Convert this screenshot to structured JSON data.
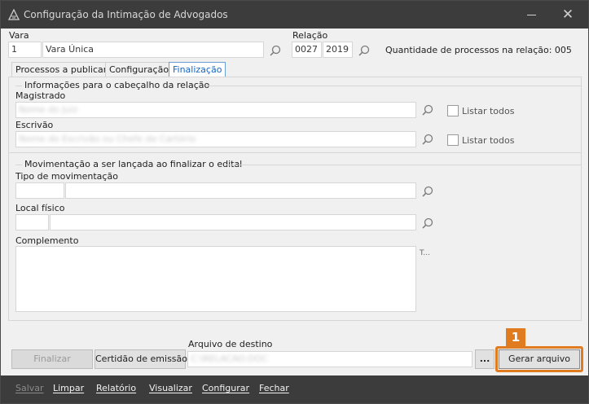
{
  "window": {
    "title": "Configuração da Intimação de Advogados",
    "close_glyph": "✕"
  },
  "vara": {
    "label": "Vara",
    "code": "1",
    "name": "Vara Única"
  },
  "relacao": {
    "label": "Relação",
    "numero": "0027",
    "ano": "2019",
    "quantidade_text": "Quantidade de processos na relação: 005"
  },
  "tabs": [
    {
      "label": "Processos a publicar",
      "active": false
    },
    {
      "label": "Configuração",
      "active": false
    },
    {
      "label": "Finalização",
      "active": true
    }
  ],
  "cabecalho": {
    "title": "Informações para o cabeçalho da relação",
    "magistrado_label": "Magistrado",
    "magistrado_value": "Nome do Juiz",
    "escrivao_label": "Escrivão",
    "escrivao_value": "Nome do Escrivão ou Chefe de Cartório",
    "listar_todos": "Listar todos"
  },
  "movimentacao": {
    "title": "Movimentação a ser lançada ao finalizar o edital",
    "tipo_label": "Tipo de movimentação",
    "local_label": "Local físico",
    "complemento_label": "Complemento",
    "ellipsis": "T..."
  },
  "actions": {
    "finalizar": "Finalizar",
    "certidao": "Certidão de emissão",
    "arquivo_label": "Arquivo de destino",
    "arquivo_value": "C:\\RELACAO.DOC",
    "browse": "...",
    "gerar": "Gerar arquivo",
    "annotation_number": "1"
  },
  "footer_menu": [
    {
      "label": "Salvar",
      "disabled": true
    },
    {
      "label": "Limpar",
      "disabled": false
    },
    {
      "label": "Relatório",
      "disabled": false
    },
    {
      "label": "Visualizar",
      "disabled": false
    },
    {
      "label": "Configurar",
      "disabled": false
    },
    {
      "label": "Fechar",
      "disabled": false
    }
  ],
  "colors": {
    "titlebar": "#3c3c3c",
    "accent": "#1565c0",
    "annotation": "#e07b20"
  }
}
